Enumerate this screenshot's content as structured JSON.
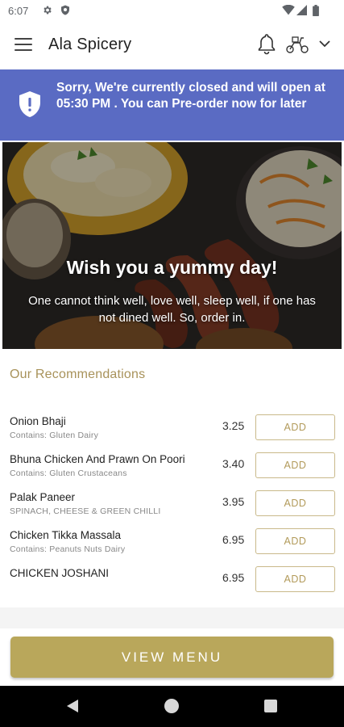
{
  "status_bar": {
    "time": "6:07",
    "icons": [
      "gear-icon",
      "shield-status-icon",
      "wifi-icon",
      "signal-icon",
      "battery-icon"
    ]
  },
  "app_bar": {
    "title": "Ala Spicery",
    "icons": [
      "hamburger-menu-icon",
      "bell-icon",
      "delivery-scooter-icon",
      "chevron-down-icon"
    ]
  },
  "notice": {
    "text": "Sorry, We're currently closed and will open at 05:30 PM . You can Pre-order now for later",
    "background": "#5a6bc3",
    "icon": "shield-alert-icon"
  },
  "hero": {
    "title": "Wish you a yummy day!",
    "subtitle": "One cannot think well, love well, sleep well, if one has not dined well. So, order in."
  },
  "recommendations": {
    "title": "Our Recommendations",
    "items": [
      {
        "name": "Onion Bhaji",
        "contains": "Contains:  Gluten  Dairy",
        "price": "3.25",
        "add_label": "ADD"
      },
      {
        "name": "Bhuna Chicken And Prawn On Poori",
        "contains": "Contains:  Gluten  Crustaceans",
        "price": "3.40",
        "add_label": "ADD"
      },
      {
        "name": "Palak Paneer",
        "contains": "SPINACH, CHEESE & GREEN CHILLI",
        "price": "3.95",
        "add_label": "ADD"
      },
      {
        "name": "Chicken Tikka Massala",
        "contains": "Contains:  Peanuts  Nuts  Dairy",
        "price": "6.95",
        "add_label": "ADD"
      },
      {
        "name": "CHICKEN JOSHANI",
        "contains": "",
        "price": "6.95",
        "add_label": "ADD"
      }
    ]
  },
  "view_menu_label": "VIEW MENU",
  "colors": {
    "accent_gold": "#b9a75b",
    "notice_blue": "#5a6bc3"
  },
  "nav_bar": {
    "icons": [
      "back-nav-icon",
      "home-nav-icon",
      "recents-nav-icon"
    ]
  }
}
